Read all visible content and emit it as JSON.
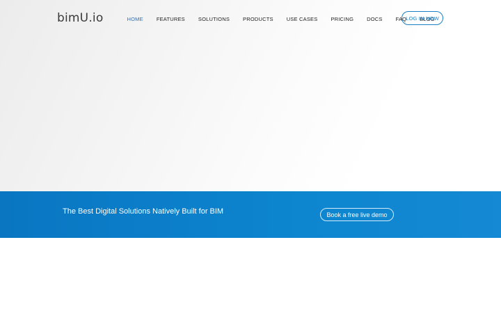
{
  "header": {
    "logo": "bimU.io",
    "nav": [
      "HOME",
      "FEATURES",
      "SOLUTIONS",
      "PRODUCTS",
      "USE CASES",
      "PRICING",
      "DOCS",
      "FAQ",
      "BLOG"
    ],
    "active": "HOME",
    "login_label": "LOG IN NOW"
  },
  "band": {
    "tagline": "The Best Digital Solutions Natively Built for BIM",
    "cta_label": "Book a free live demo"
  },
  "colors": {
    "accent": "#1b7fc4",
    "active_nav": "#2a72b8",
    "band_blue": "#0a76c2"
  }
}
